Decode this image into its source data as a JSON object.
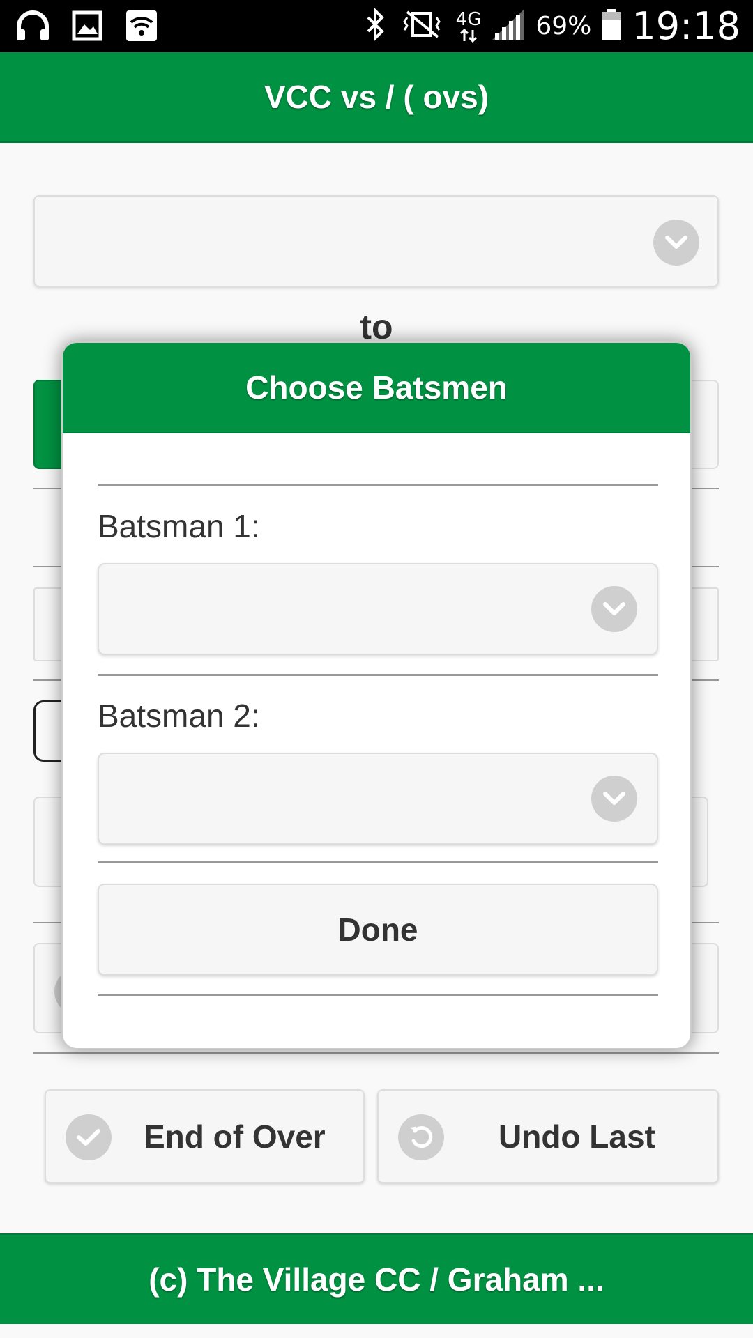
{
  "status_bar": {
    "battery": "69%",
    "time": "19:18",
    "network": "4G",
    "icons_left": [
      "headphones-icon",
      "image-icon",
      "wifi-icon"
    ],
    "icons_right": [
      "bluetooth-icon",
      "vibrate-mute-icon",
      "4g-data-icon",
      "signal-icon",
      "battery-icon"
    ]
  },
  "header": {
    "title": "VCC vs / ( ovs)"
  },
  "background": {
    "to_label": "to"
  },
  "actions": {
    "end_of_over": "End of Over",
    "undo_last": "Undo Last"
  },
  "dialog": {
    "title": "Choose Batsmen",
    "batsman1_label": "Batsman 1:",
    "batsman1_value": "",
    "batsman2_label": "Batsman 2:",
    "batsman2_value": "",
    "done_label": "Done"
  },
  "footer": {
    "text": "(c) The Village CC / Graham ..."
  },
  "colors": {
    "brand_green": "#009242",
    "page_bg": "#f9f9f9",
    "control_bg": "#f6f6f6",
    "icon_grey": "#cfcfcf"
  }
}
